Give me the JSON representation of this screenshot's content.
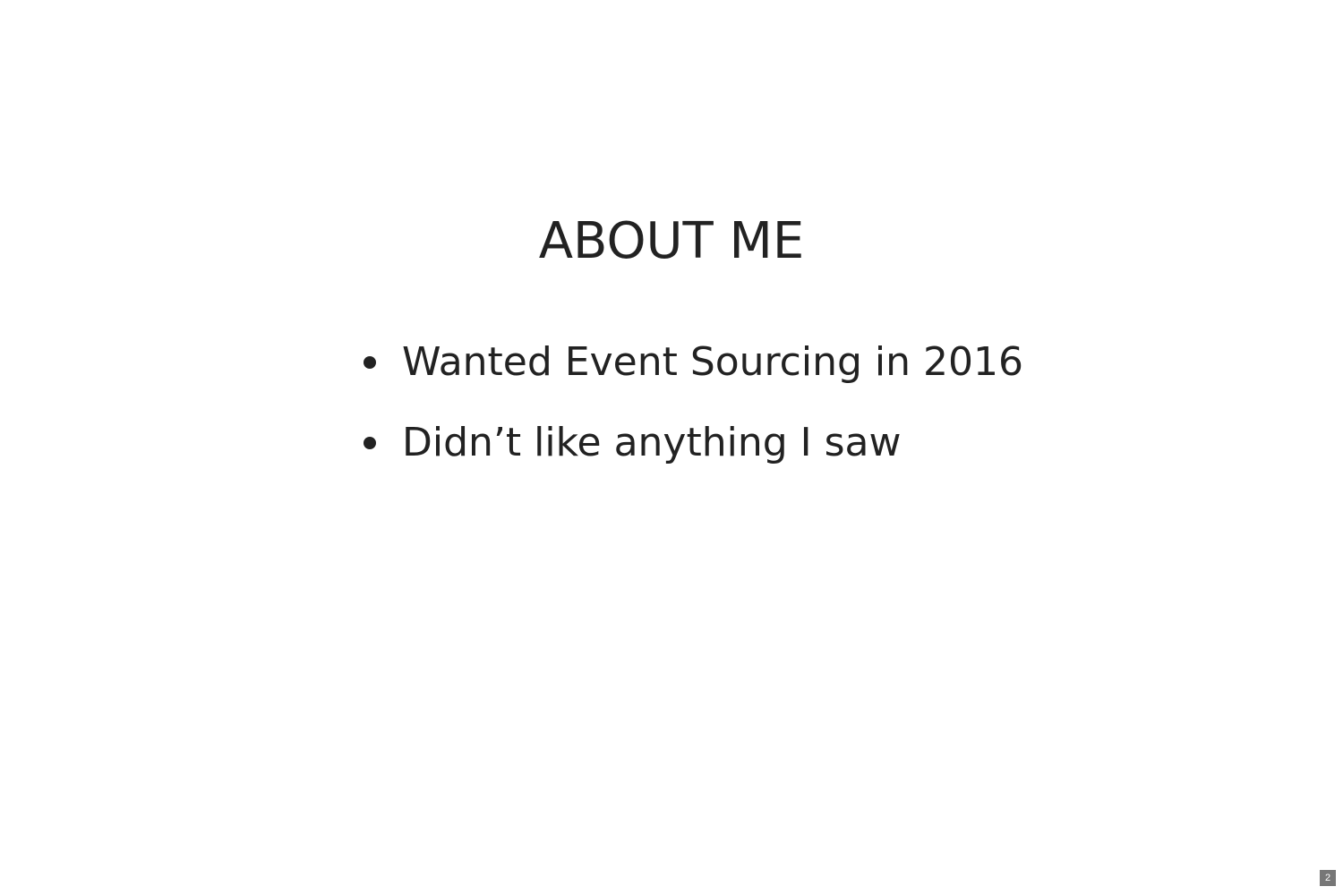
{
  "slide": {
    "title": "ABOUT ME",
    "bullets": [
      "Wanted Event Sourcing in 2016",
      "Didn’t like anything I saw"
    ],
    "page_number": "2"
  },
  "colors": {
    "background": "#ffffff",
    "text": "#222222",
    "page_badge": "#777777"
  }
}
